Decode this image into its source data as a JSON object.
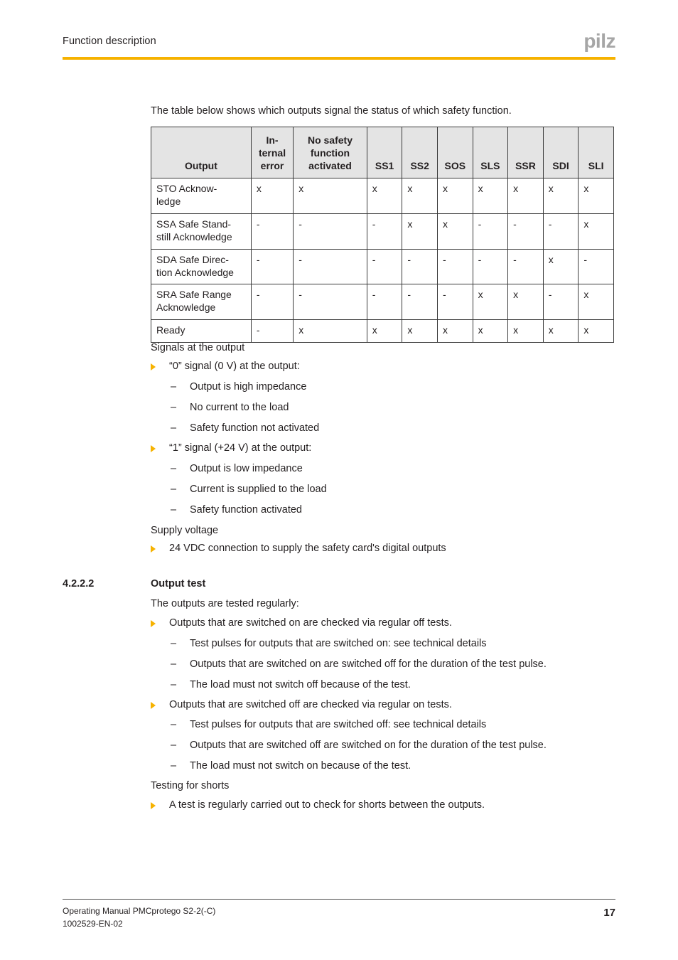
{
  "header": {
    "title": "Function description",
    "logo_text": "pilz",
    "rule_color": "#f6b200",
    "logo_color": "#a6a6a6"
  },
  "intro": {
    "text": "The table below shows which outputs signal the status of which safety function."
  },
  "table": {
    "columns": [
      "Output",
      "In-ternal error",
      "No safety function activated",
      "SS1",
      "SS2",
      "SOS",
      "SLS",
      "SSR",
      "SDI",
      "SLI"
    ],
    "column_display": [
      [
        "Output"
      ],
      [
        "In-",
        "ternal",
        "error"
      ],
      [
        "No safety",
        "function",
        "activated"
      ],
      [
        "SS1"
      ],
      [
        "SS2"
      ],
      [
        "SOS"
      ],
      [
        "SLS"
      ],
      [
        "SSR"
      ],
      [
        "SDI"
      ],
      [
        "SLI"
      ]
    ],
    "header_bg": "#e4e4e4",
    "rows": [
      {
        "label": "STO Acknow-ledge",
        "label_lines": [
          "STO Acknow-",
          "ledge"
        ],
        "values": [
          "x",
          "x",
          "x",
          "x",
          "x",
          "x",
          "x",
          "x",
          "x"
        ]
      },
      {
        "label": "SSA Safe Standstill Acknowledge",
        "label_lines": [
          "SSA Safe Stand-",
          "still Acknowledge"
        ],
        "values": [
          "-",
          "-",
          "-",
          "x",
          "x",
          "-",
          "-",
          "-",
          "x"
        ]
      },
      {
        "label": "SDA Safe Direction Acknowledge",
        "label_lines": [
          "SDA Safe Direc-",
          "tion Acknowledge"
        ],
        "values": [
          "-",
          "-",
          "-",
          "-",
          "-",
          "-",
          "-",
          "x",
          "-"
        ]
      },
      {
        "label": "SRA Safe Range Acknowledge",
        "label_lines": [
          "SRA Safe Range",
          "Acknowledge"
        ],
        "values": [
          "-",
          "-",
          "-",
          "-",
          "-",
          "x",
          "x",
          "-",
          "x"
        ]
      },
      {
        "label": "Ready",
        "label_lines": [
          "Ready"
        ],
        "values": [
          "-",
          "x",
          "x",
          "x",
          "x",
          "x",
          "x",
          "x",
          "x"
        ]
      }
    ]
  },
  "signals_section": {
    "lead": "Signals at the output",
    "bullets": [
      {
        "text": "“0” signal (0 V) at the output:",
        "subs": [
          "Output is high impedance",
          "No current to the load",
          "Safety function not activated"
        ]
      },
      {
        "text": "“1” signal (+24 V) at the output:",
        "subs": [
          "Output is low impedance",
          "Current is supplied to the load",
          "Safety function activated"
        ]
      }
    ]
  },
  "supply_section": {
    "lead": "Supply voltage",
    "bullets": [
      {
        "text": "24 VDC connection to supply the safety card's digital outputs",
        "subs": []
      }
    ]
  },
  "output_test_section": {
    "number": "4.2.2.2",
    "title": "Output test",
    "lead": "The outputs are tested regularly:",
    "bullets": [
      {
        "text": "Outputs that are switched on are checked via regular off tests.",
        "subs": [
          "Test pulses for outputs that are switched on: see technical details",
          "Outputs that are switched on are switched off for the duration of the test pulse.",
          "The load must not switch off because of the test."
        ]
      },
      {
        "text": "Outputs that are switched off are checked via regular on tests.",
        "subs": [
          "Test pulses for outputs that are switched off: see technical details",
          "Outputs that are switched off are switched on for the duration of the test pulse.",
          "The load must not switch on because of the test."
        ]
      }
    ]
  },
  "shorts_section": {
    "lead": "Testing for shorts",
    "bullets": [
      {
        "text": "A test is regularly carried out to check for shorts between the outputs.",
        "subs": []
      }
    ]
  },
  "footer": {
    "line1": "Operating Manual PMCprotego S2-2(-C)",
    "line2": "1002529-EN-02",
    "page_number": "17"
  },
  "dash_glyph": "–"
}
